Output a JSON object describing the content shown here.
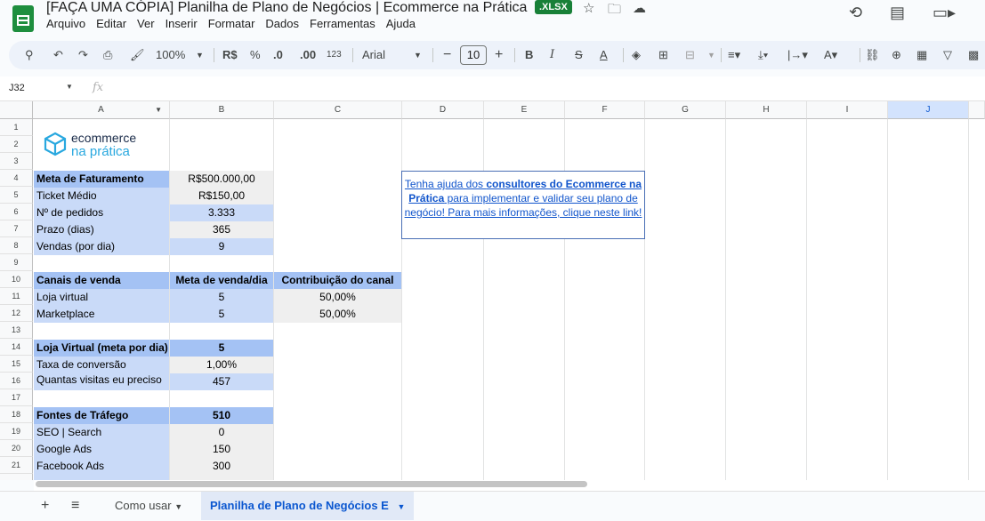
{
  "window": {
    "title": "[FAÇA UMA CÓPIA] Planilha de Plano de Negócios | Ecommerce na Prática",
    "file_badge": ".XLSX"
  },
  "menu": [
    "Arquivo",
    "Editar",
    "Ver",
    "Inserir",
    "Formatar",
    "Dados",
    "Ferramentas",
    "Ajuda"
  ],
  "toolbar": {
    "zoom": "100%",
    "currency": "R$",
    "percent": "%",
    "decimal_decrease": ".0",
    "decimal_increase": ".00",
    "number_format": "123",
    "font": "Arial",
    "font_size": "10"
  },
  "formula_bar": {
    "cell_ref": "J32",
    "fx": "fx"
  },
  "columns": [
    "A",
    "B",
    "C",
    "D",
    "E",
    "F",
    "G",
    "H",
    "I",
    "J"
  ],
  "rows": [
    "1",
    "2",
    "3",
    "4",
    "5",
    "6",
    "7",
    "8",
    "9",
    "10",
    "11",
    "12",
    "13",
    "14",
    "15",
    "16",
    "17",
    "18",
    "19",
    "20",
    "21"
  ],
  "logo": {
    "line1": "ecommerce",
    "line2": "na prática"
  },
  "meta": {
    "meta_faturamento_label": "Meta de Faturamento",
    "meta_faturamento_value": "R$500.000,00",
    "ticket_label": "Ticket Médio",
    "ticket_value": "R$150,00",
    "pedidos_label": "Nº de pedidos",
    "pedidos_value": "3.333",
    "prazo_label": "Prazo (dias)",
    "prazo_value": "365",
    "vendas_label": "Vendas (por dia)",
    "vendas_value": "9"
  },
  "canais": {
    "header_label": "Canais de venda",
    "header_meta": "Meta de venda/dia",
    "header_contrib": "Contribuição do canal",
    "loja_label": "Loja virtual",
    "loja_meta": "5",
    "loja_contrib": "50,00%",
    "market_label": "Marketplace",
    "market_meta": "5",
    "market_contrib": "50,00%"
  },
  "loja_virtual": {
    "header_label": "Loja Virtual (meta por dia)",
    "header_value": "5",
    "taxa_label": "Taxa de conversão",
    "taxa_value": "1,00%",
    "visitas_label": "Quantas visitas eu preciso",
    "visitas_value": "457"
  },
  "fontes": {
    "header_label": "Fontes de Tráfego",
    "header_value": "510",
    "seo_label": "SEO | Search",
    "seo_value": "0",
    "google_label": "Google Ads",
    "google_value": "150",
    "facebook_label": "Facebook Ads",
    "facebook_value": "300"
  },
  "cta": {
    "part1": "Tenha ajuda dos ",
    "part2_bold": "consultores do Ecommerce na Prática",
    "part3": " para implementar e validar seu plano de negócio! Para mais informações, clique neste link!"
  },
  "sheet_tabs": {
    "tab1": "Como usar",
    "tab2": "Planilha de Plano de Negócios E"
  }
}
